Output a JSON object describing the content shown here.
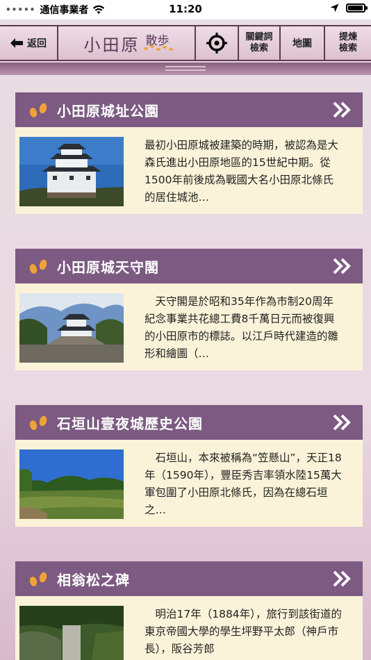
{
  "status_bar": {
    "carrier": "通信事業者",
    "time": "11:20",
    "battery_level": 0.95
  },
  "toolbar": {
    "back_label": "返回",
    "logo_main": "小田原",
    "logo_sub": "散歩",
    "keyword_search_line1": "關鍵詞",
    "keyword_search_line2": "檢索",
    "map_label": "地圖",
    "refine_search_line1": "提煉",
    "refine_search_line2": "檢索"
  },
  "colors": {
    "header_purple": "#7c5a82",
    "card_cream": "#fbf3d9",
    "footprint_orange": "#f0a23a"
  },
  "items": [
    {
      "title": "小田原城址公園",
      "description": "最初小田原城被建築的時期，被認為是大森氏進出小田原地區的15世紀中期。從1500年前後成為戰國大名小田原北條氏的居住城池…",
      "image": "odawara-castle-photo"
    },
    {
      "title": "小田原城天守閣",
      "description": "　天守閣是於昭和35年作為市制20周年紀念事業共花總工費8千萬日元而被復興的小田原市的標誌。以江戶時代建造的雛形和繪圖（…",
      "image": "castle-keep-photo"
    },
    {
      "title": "石垣山壹夜城歷史公園",
      "description": "　石垣山，本來被稱為“笠懸山”，天正18年（1590年），豐臣秀吉率領水陸15萬大軍包圍了小田原北條氏，因為在總石垣之…",
      "image": "ishigakiyama-park-photo"
    },
    {
      "title": "相翁松之碑",
      "description": "　明治17年（1884年），旅行到該街道的東京帝國大學的學生坪野平太郎（神戶市長），阪谷芳郎",
      "image": "monument-photo"
    }
  ]
}
